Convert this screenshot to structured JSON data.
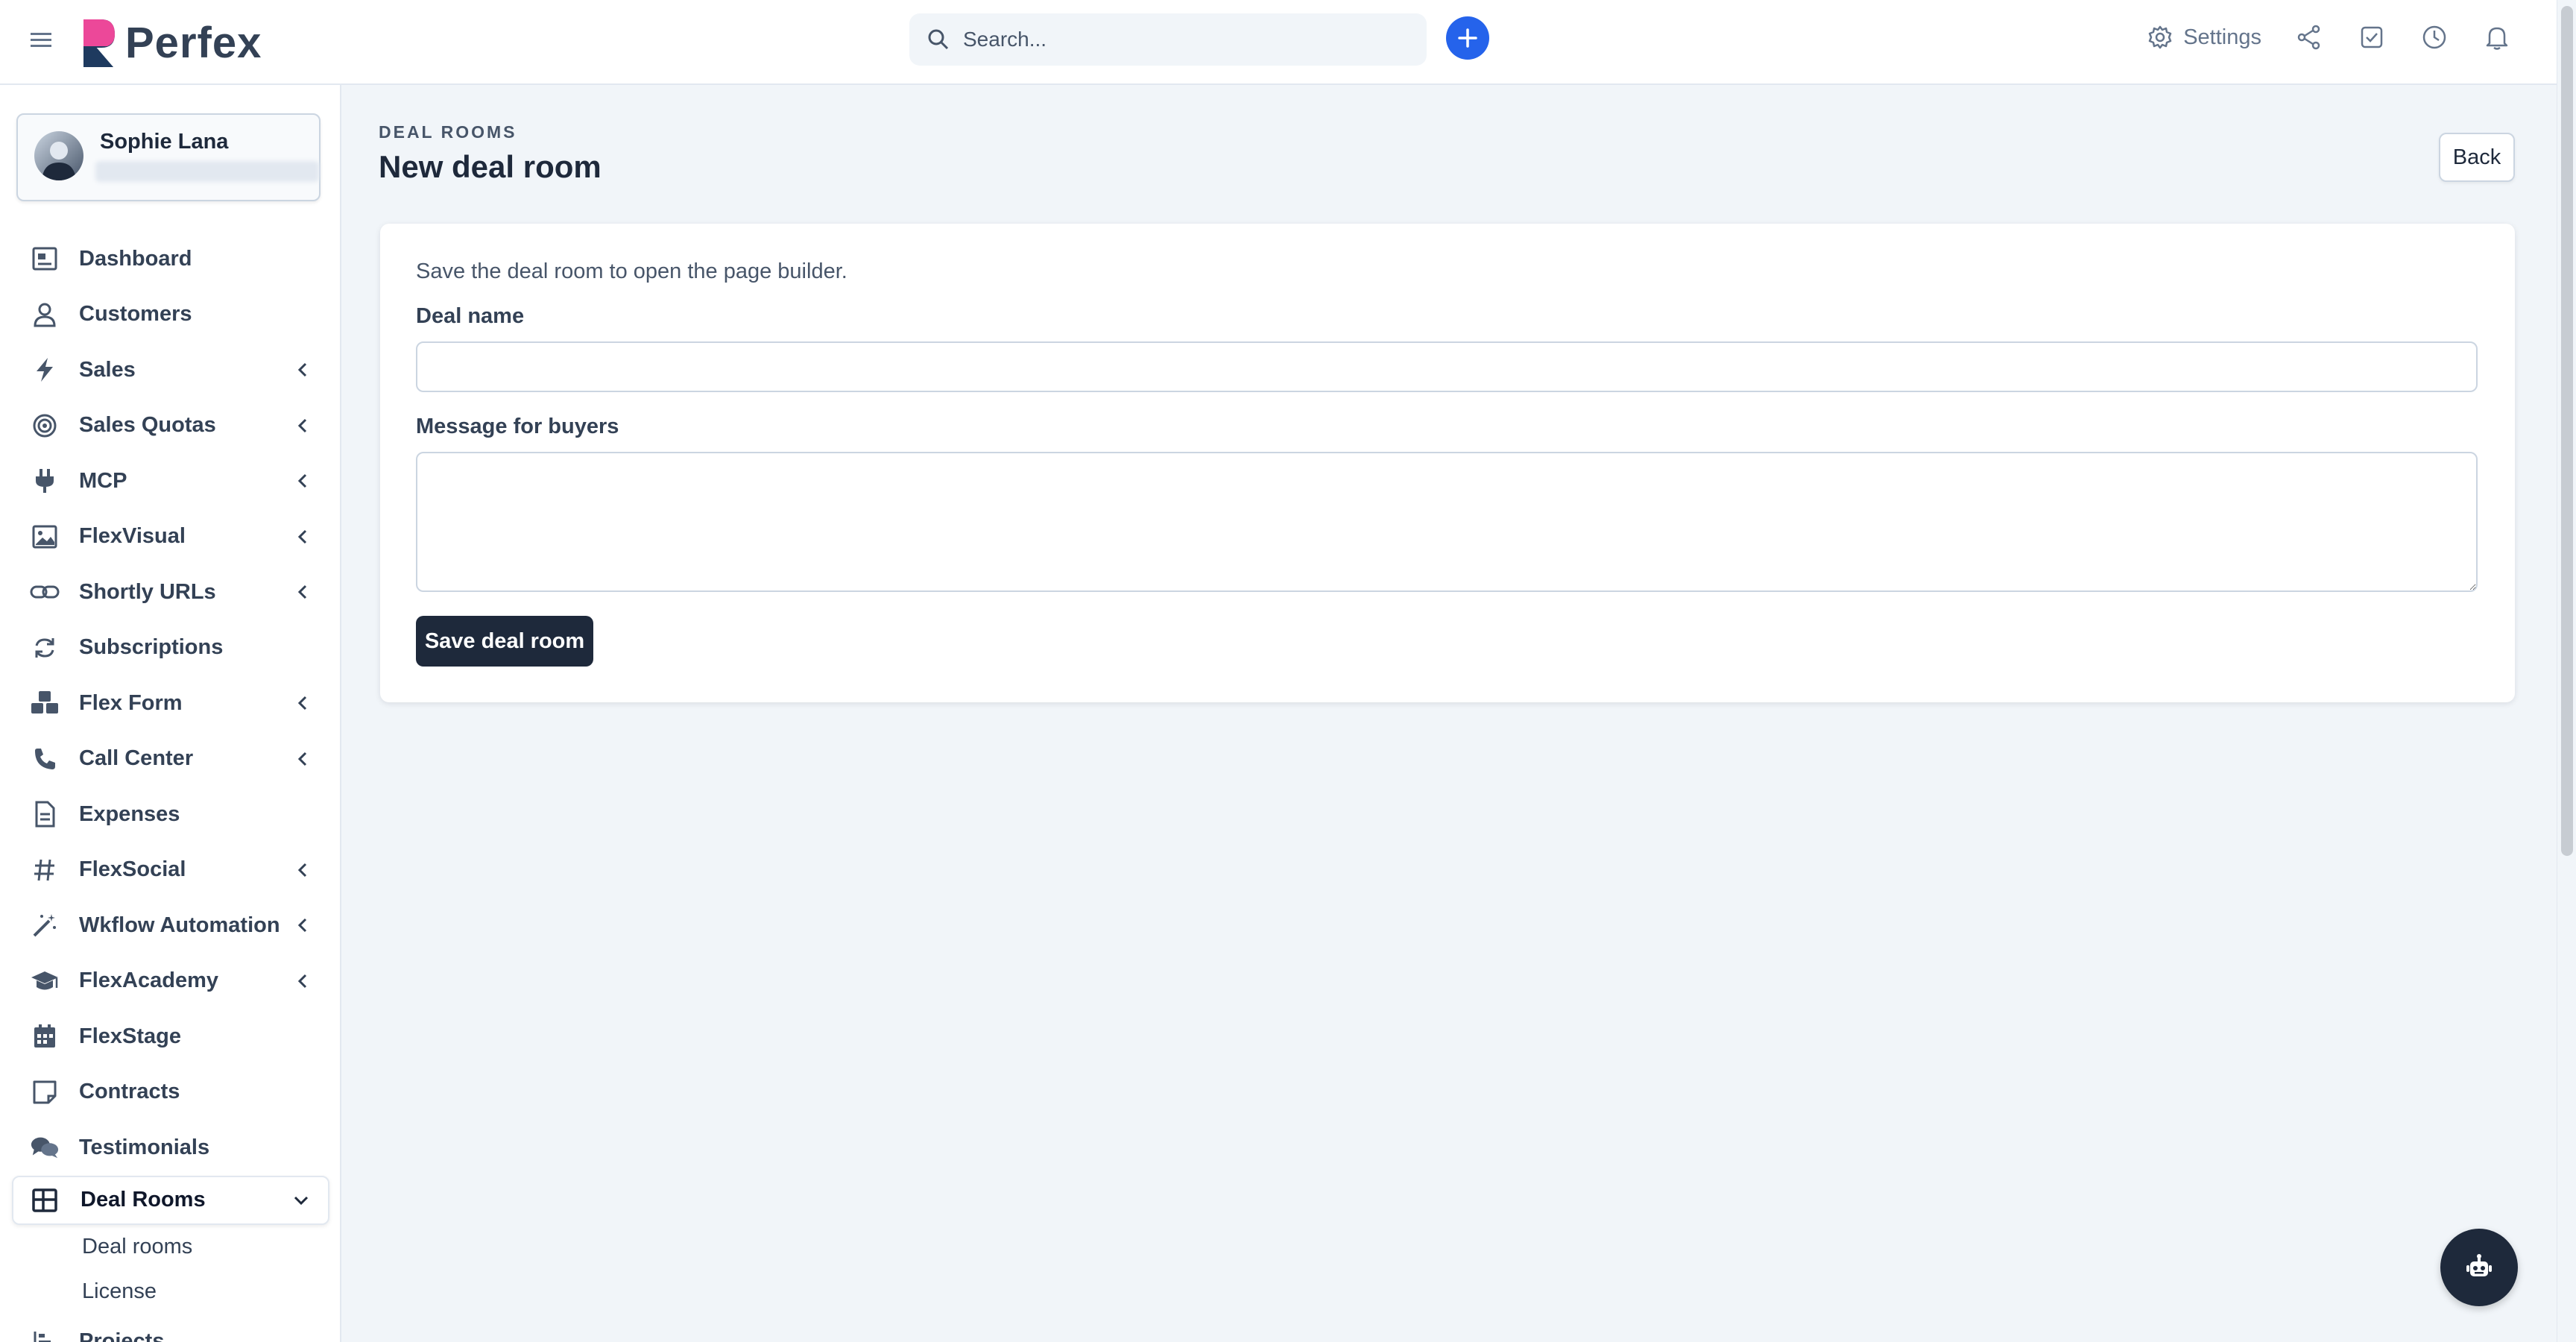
{
  "header": {
    "logo_text": "Perfex",
    "search_placeholder": "Search...",
    "settings_label": "Settings"
  },
  "user": {
    "name": "Sophie Lana"
  },
  "sidebar": {
    "items": [
      {
        "label": "Dashboard",
        "icon": "dashboard-icon",
        "has_children": false
      },
      {
        "label": "Customers",
        "icon": "user-icon",
        "has_children": false
      },
      {
        "label": "Sales",
        "icon": "bolt-icon",
        "has_children": true
      },
      {
        "label": "Sales Quotas",
        "icon": "target-icon",
        "has_children": true
      },
      {
        "label": "MCP",
        "icon": "plug-icon",
        "has_children": true
      },
      {
        "label": "FlexVisual",
        "icon": "image-icon",
        "has_children": true
      },
      {
        "label": "Shortly URLs",
        "icon": "link-icon",
        "has_children": true
      },
      {
        "label": "Subscriptions",
        "icon": "refresh-icon",
        "has_children": false
      },
      {
        "label": "Flex Form",
        "icon": "cubes-icon",
        "has_children": true
      },
      {
        "label": "Call Center",
        "icon": "phone-icon",
        "has_children": true
      },
      {
        "label": "Expenses",
        "icon": "document-icon",
        "has_children": false
      },
      {
        "label": "FlexSocial",
        "icon": "hashtag-icon",
        "has_children": true
      },
      {
        "label": "Wkflow Automation",
        "icon": "magic-wand-icon",
        "has_children": true
      },
      {
        "label": "FlexAcademy",
        "icon": "graduation-cap-icon",
        "has_children": true
      },
      {
        "label": "FlexStage",
        "icon": "calendar-icon",
        "has_children": false
      },
      {
        "label": "Contracts",
        "icon": "note-icon",
        "has_children": false
      },
      {
        "label": "Testimonials",
        "icon": "comments-icon",
        "has_children": false
      }
    ],
    "active": {
      "label": "Deal Rooms",
      "icon": "table-icon"
    },
    "subitems": [
      {
        "label": "Deal rooms"
      },
      {
        "label": "License"
      }
    ],
    "partial_item": {
      "label": "Projects"
    }
  },
  "page": {
    "breadcrumb": "DEAL ROOMS",
    "title": "New deal room",
    "back_label": "Back"
  },
  "form": {
    "hint": "Save the deal room to open the page builder.",
    "deal_name_label": "Deal name",
    "deal_name_value": "",
    "message_label": "Message for buyers",
    "message_value": "",
    "save_label": "Save deal room"
  },
  "colors": {
    "accent": "#2563eb",
    "primary_dark": "#1e293b"
  }
}
